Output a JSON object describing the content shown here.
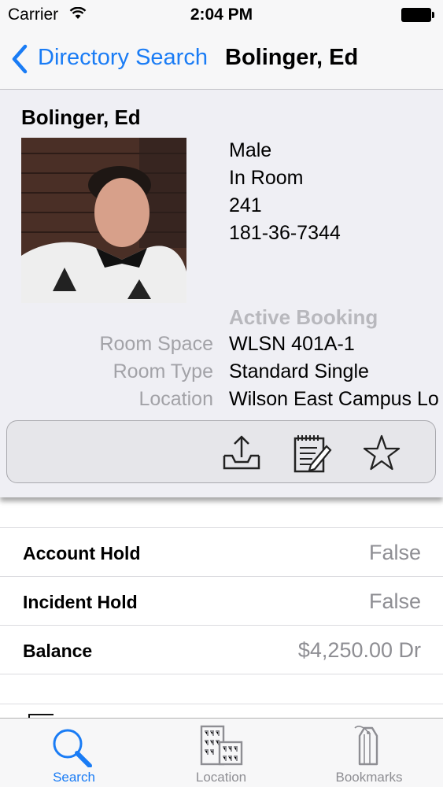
{
  "status": {
    "carrier": "Carrier",
    "time": "2:04 PM"
  },
  "nav": {
    "back_label": "Directory Search",
    "title": "Bolinger, Ed"
  },
  "profile": {
    "name": "Bolinger, Ed",
    "gender": "Male",
    "status": "In Room",
    "room_number": "241",
    "id_number": "181-36-7344",
    "booking_title": "Active Booking",
    "room_space_label": "Room Space",
    "room_space_value": "WLSN 401A-1",
    "room_type_label": "Room Type",
    "room_type_value": "Standard Single",
    "location_label": "Location",
    "location_value": "Wilson East Campus Lo"
  },
  "actions": {
    "icons": [
      "share-icon",
      "notepad-icon",
      "star-icon"
    ]
  },
  "rows": [
    {
      "label": "Account Hold",
      "value": "False"
    },
    {
      "label": "Incident Hold",
      "value": "False"
    },
    {
      "label": "Balance",
      "value": "$4,250.00 Dr"
    }
  ],
  "tabs": [
    {
      "label": "Search",
      "icon": "search-icon",
      "active": true
    },
    {
      "label": "Location",
      "icon": "building-icon",
      "active": false
    },
    {
      "label": "Bookmarks",
      "icon": "bookmark-icon",
      "active": false
    }
  ],
  "colors": {
    "accent": "#1a7cf5",
    "muted": "#8e8e93",
    "label_gray": "#a2a2a7"
  }
}
